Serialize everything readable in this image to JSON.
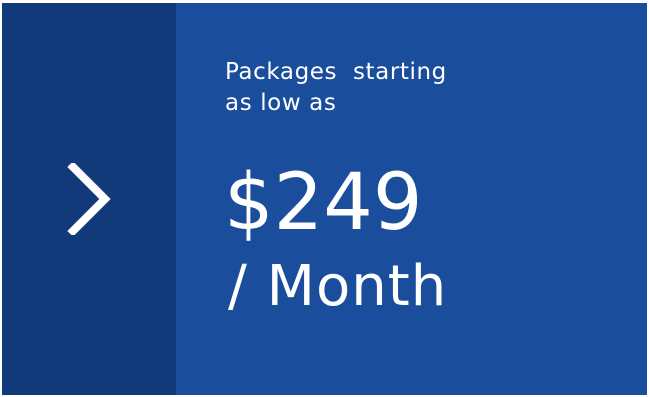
{
  "promo": {
    "tagline_line1": "Packages  starting",
    "tagline_line2": "as low as",
    "price": "$249",
    "period": "/ Month"
  },
  "nav": {
    "icon": "chevron-right-icon"
  },
  "colors": {
    "side_panel": "#12397a",
    "main_panel": "#1a4e9c",
    "text": "#ffffff"
  }
}
